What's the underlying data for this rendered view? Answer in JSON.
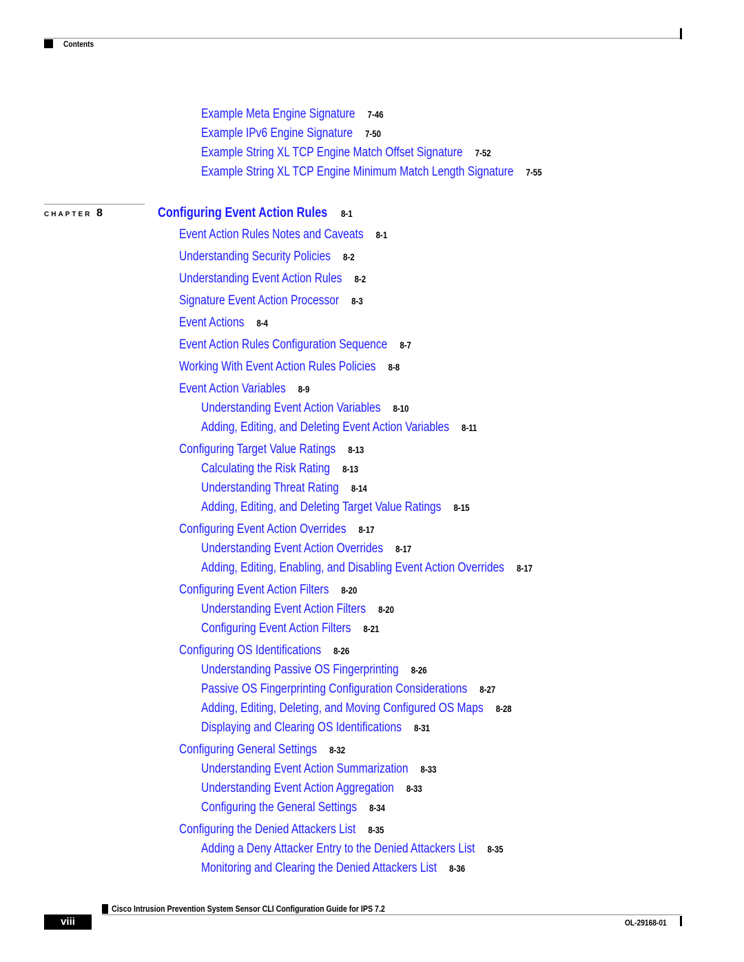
{
  "header": {
    "section_label": "Contents"
  },
  "pre_entries": [
    {
      "title": "Example Meta Engine Signature",
      "page": "7-46"
    },
    {
      "title": "Example IPv6 Engine Signature",
      "page": "7-50"
    },
    {
      "title": "Example String XL TCP Engine Match Offset Signature",
      "page": "7-52"
    },
    {
      "title": "Example String XL TCP Engine Minimum Match Length Signature",
      "page": "7-55"
    }
  ],
  "chapter": {
    "label": "CHAPTER",
    "number": "8",
    "title": "Configuring Event Action Rules",
    "page": "8-1"
  },
  "entries": [
    {
      "level": 1,
      "title": "Event Action Rules Notes and Caveats",
      "page": "8-1"
    },
    {
      "level": 1,
      "title": "Understanding Security Policies",
      "page": "8-2"
    },
    {
      "level": 1,
      "title": "Understanding Event Action Rules",
      "page": "8-2"
    },
    {
      "level": 1,
      "title": "Signature Event Action Processor",
      "page": "8-3"
    },
    {
      "level": 1,
      "title": "Event Actions",
      "page": "8-4"
    },
    {
      "level": 1,
      "title": "Event Action Rules Configuration Sequence",
      "page": "8-7"
    },
    {
      "level": 1,
      "title": "Working With Event Action Rules Policies",
      "page": "8-8"
    },
    {
      "level": 1,
      "title": "Event Action Variables",
      "page": "8-9"
    },
    {
      "level": 2,
      "title": "Understanding Event Action Variables",
      "page": "8-10"
    },
    {
      "level": 2,
      "title": "Adding, Editing, and Deleting Event Action Variables",
      "page": "8-11"
    },
    {
      "level": 1,
      "title": "Configuring Target Value Ratings",
      "page": "8-13"
    },
    {
      "level": 2,
      "title": "Calculating the Risk Rating",
      "page": "8-13"
    },
    {
      "level": 2,
      "title": "Understanding Threat Rating",
      "page": "8-14"
    },
    {
      "level": 2,
      "title": "Adding, Editing, and Deleting Target Value Ratings",
      "page": "8-15"
    },
    {
      "level": 1,
      "title": "Configuring Event Action Overrides",
      "page": "8-17"
    },
    {
      "level": 2,
      "title": "Understanding Event Action Overrides",
      "page": "8-17"
    },
    {
      "level": 2,
      "title": "Adding, Editing, Enabling, and Disabling Event Action Overrides",
      "page": "8-17"
    },
    {
      "level": 1,
      "title": "Configuring Event Action Filters",
      "page": "8-20"
    },
    {
      "level": 2,
      "title": "Understanding Event Action Filters",
      "page": "8-20"
    },
    {
      "level": 2,
      "title": "Configuring Event Action Filters",
      "page": "8-21"
    },
    {
      "level": 1,
      "title": "Configuring OS Identifications",
      "page": "8-26"
    },
    {
      "level": 2,
      "title": "Understanding Passive OS Fingerprinting",
      "page": "8-26"
    },
    {
      "level": 2,
      "title": "Passive OS Fingerprinting Configuration Considerations",
      "page": "8-27"
    },
    {
      "level": 2,
      "title": "Adding, Editing, Deleting, and Moving Configured OS Maps",
      "page": "8-28"
    },
    {
      "level": 2,
      "title": "Displaying and Clearing OS Identifications",
      "page": "8-31"
    },
    {
      "level": 1,
      "title": "Configuring General Settings",
      "page": "8-32"
    },
    {
      "level": 2,
      "title": "Understanding Event Action Summarization",
      "page": "8-33"
    },
    {
      "level": 2,
      "title": "Understanding Event Action Aggregation",
      "page": "8-33"
    },
    {
      "level": 2,
      "title": "Configuring the General Settings",
      "page": "8-34"
    },
    {
      "level": 1,
      "title": "Configuring the Denied Attackers List",
      "page": "8-35"
    },
    {
      "level": 2,
      "title": "Adding a Deny Attacker Entry to the Denied Attackers List",
      "page": "8-35"
    },
    {
      "level": 2,
      "title": "Monitoring and Clearing the Denied Attackers List",
      "page": "8-36"
    }
  ],
  "footer": {
    "guide_title": "Cisco Intrusion Prevention System Sensor CLI Configuration Guide for IPS 7.2",
    "page_number": "viii",
    "doc_number": "OL-29168-01"
  },
  "colors": {
    "link": "#1a1aff",
    "text": "#000000",
    "rule": "#888888"
  }
}
